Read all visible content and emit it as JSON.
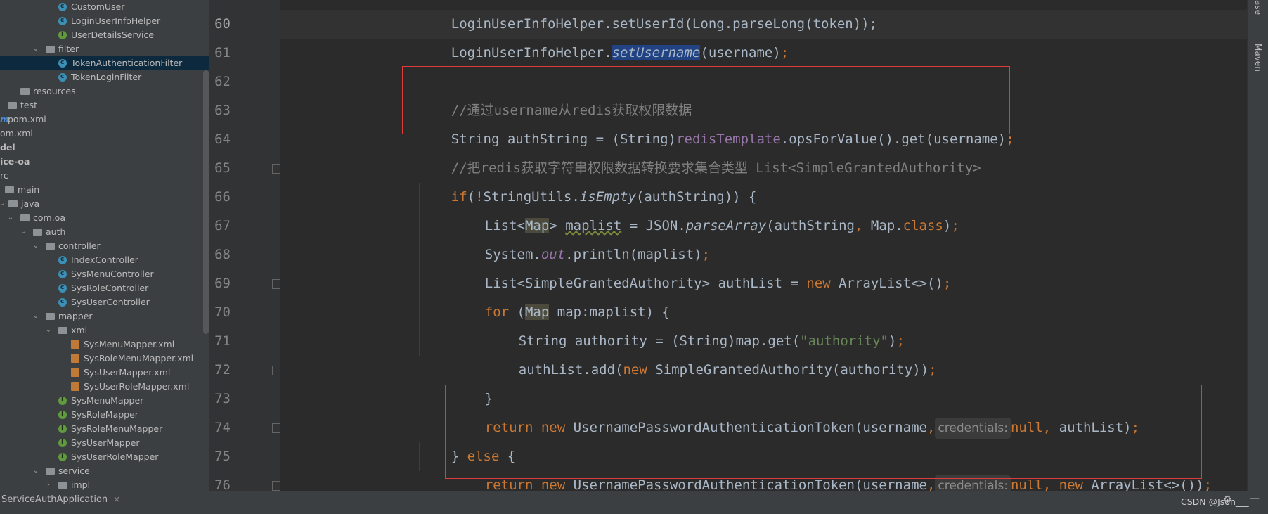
{
  "tree": {
    "items": [
      {
        "label": "CustomUser",
        "icon": "class-icon"
      },
      {
        "label": "LoginUserInfoHelper",
        "icon": "class-icon"
      },
      {
        "label": "UserDetailsService",
        "icon": "interface-icon"
      },
      {
        "label": "filter",
        "icon": "folder-icon"
      },
      {
        "label": "TokenAuthenticationFilter",
        "icon": "class-icon"
      },
      {
        "label": "TokenLoginFilter",
        "icon": "class-icon"
      },
      {
        "label": "resources",
        "icon": "folder-icon"
      },
      {
        "label": "test",
        "icon": "folder-icon"
      },
      {
        "label": "pom.xml",
        "icon": "maven-icon"
      },
      {
        "label": "om.xml",
        "icon": "maven-icon"
      },
      {
        "label": "del",
        "icon": ""
      },
      {
        "label": "ice-oa",
        "icon": ""
      },
      {
        "label": "rc",
        "icon": ""
      },
      {
        "label": "main",
        "icon": "folder-icon"
      },
      {
        "label": "java",
        "icon": "folder-icon"
      },
      {
        "label": "com.oa",
        "icon": "folder-icon"
      },
      {
        "label": "auth",
        "icon": "folder-icon"
      },
      {
        "label": "controller",
        "icon": "folder-icon"
      },
      {
        "label": "IndexController",
        "icon": "class-icon"
      },
      {
        "label": "SysMenuController",
        "icon": "class-icon"
      },
      {
        "label": "SysRoleController",
        "icon": "class-icon"
      },
      {
        "label": "SysUserController",
        "icon": "class-icon"
      },
      {
        "label": "mapper",
        "icon": "folder-icon"
      },
      {
        "label": "xml",
        "icon": "folder-icon"
      },
      {
        "label": "SysMenuMapper.xml",
        "icon": "xml-icon"
      },
      {
        "label": "SysRoleMenuMapper.xml",
        "icon": "xml-icon"
      },
      {
        "label": "SysUserMapper.xml",
        "icon": "xml-icon"
      },
      {
        "label": "SysUserRoleMapper.xml",
        "icon": "xml-icon"
      },
      {
        "label": "SysMenuMapper",
        "icon": "interface-icon"
      },
      {
        "label": "SysRoleMapper",
        "icon": "interface-icon"
      },
      {
        "label": "SysRoleMenuMapper",
        "icon": "interface-icon"
      },
      {
        "label": "SysUserMapper",
        "icon": "interface-icon"
      },
      {
        "label": "SysUserRoleMapper",
        "icon": "interface-icon"
      },
      {
        "label": "service",
        "icon": "folder-icon"
      },
      {
        "label": "impl",
        "icon": "folder-icon"
      }
    ],
    "selected": "TokenAuthenticationFilter"
  },
  "editor": {
    "line_numbers": [
      "60",
      "61",
      "62",
      "63",
      "64",
      "65",
      "66",
      "67",
      "68",
      "69",
      "70",
      "71",
      "72",
      "73",
      "74",
      "75",
      "76"
    ],
    "current_line": "60",
    "code": {
      "l59": "LoginUserInfoHelper.setUserId(Long.parseLong(token));",
      "l60_pre": "LoginUserInfoHelper.",
      "l60_method": "setUsername",
      "l60_post": "(username)",
      "semi": ";",
      "l62": "//通过username从redis获取权限数据",
      "l63_pre": "String authString = (String)",
      "l63_field": "redisTemplate",
      "l63_post": ".opsForValue().get(username)",
      "l64": "//把redis获取字符串权限数据转换要求集合类型 List<SimpleGrantedAuthority>",
      "kw_if": "if",
      "l65_a": "(!StringUtils.",
      "l65_method": "isEmpty",
      "l65_b": "(authString)) {",
      "l66_a": "List<",
      "map": "Map",
      "l66_b": "> ",
      "l66_var": "maplist",
      "l66_c": " = JSON.",
      "l66_method": "parseArray",
      "l66_d": "(authString",
      "comma": ",",
      "l66_e": " Map.",
      "kw_class": "class",
      "l66_f": ")",
      "l67_a": "System.",
      "l67_field": "out",
      "l67_b": ".println(maplist)",
      "l68_a": "List<SimpleGrantedAuthority> authList = ",
      "kw_new": "new",
      "l68_b": " ArrayList<>()",
      "kw_for": "for",
      "l69_a": " (",
      "l69_b": " map:maplist) {",
      "l70_a": "String authority = (String)map.get(",
      "l70_str": "\"authority\"",
      "l70_b": ")",
      "l71_a": "authList.add(",
      "l71_b": " SimpleGrantedAuthority(authority))",
      "l72": "}",
      "kw_return": "return",
      "l73_a": " UsernamePasswordAuthenticationToken(username",
      "hint": "credentials:",
      "kw_null": "null",
      "l73_b": " authList)",
      "l74_a": "} ",
      "kw_else": "else",
      "l74_b": " {",
      "l75_a": " ArrayList<>())",
      "l76": "}"
    }
  },
  "right_panel": {
    "tab_top": "ase",
    "tab_maven": "Maven"
  },
  "bottom": {
    "run_tab": "ServiceAuthApplication",
    "close": "×",
    "watermark": "CSDN @Json___"
  },
  "colors": {
    "keyword": "#cc7832",
    "comment": "#808080",
    "string": "#6a8759",
    "field": "#9876aa",
    "default": "#a9b7c6",
    "selection": "#214283",
    "annotation_box": "#e23b3b"
  }
}
